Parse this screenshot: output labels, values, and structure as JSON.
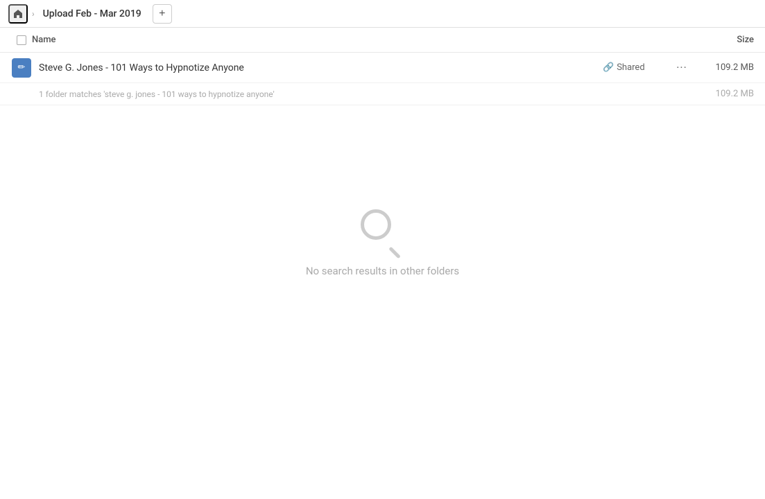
{
  "nav": {
    "home_icon": "🏠",
    "breadcrumb_title": "Upload Feb - Mar 2019",
    "add_button_label": "+",
    "chevron": "›"
  },
  "column_headers": {
    "name": "Name",
    "size": "Size"
  },
  "file": {
    "name": "Steve G. Jones - 101 Ways to Hypnotize Anyone",
    "shared_label": "Shared",
    "size": "109.2 MB",
    "icon_text": "✏"
  },
  "folder_match": {
    "text": "1 folder matches 'steve g. jones - 101 ways to hypnotize anyone'",
    "size": "109.2 MB"
  },
  "empty_state": {
    "message": "No search results in other folders"
  }
}
